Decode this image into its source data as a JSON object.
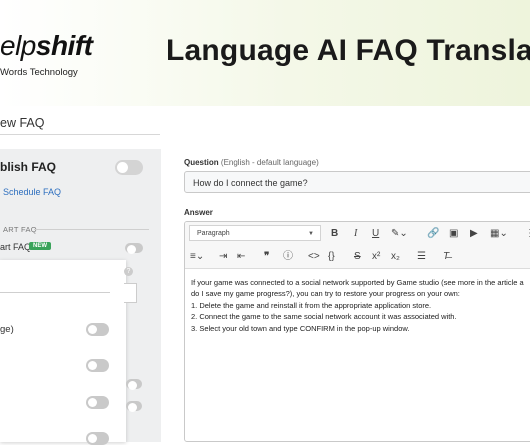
{
  "header": {
    "logo_prefix": "elp",
    "logo_bold": "shift",
    "logo_tagline": "Words Technology",
    "headline": "Language AI FAQ Translat"
  },
  "left_panel": {
    "title": "ew FAQ",
    "publish_label": "blish FAQ",
    "schedule_link": "Schedule FAQ",
    "section_label": "ART FAQ",
    "smart_label": "art FAQ",
    "new_badge": "NEW",
    "dropdown_help": "?",
    "dropdown_item": "ge)"
  },
  "form": {
    "question_label": "Question",
    "question_note": "(English - default language)",
    "question_value": "How do I connect the game?",
    "answer_label": "Answer",
    "paragraph_select": "Paragraph",
    "answer_lines": [
      "If your game was connected to a social network supported by Game studio (see more in the article a",
      "do I save my game progress?), you can try to restore your progress on your own:",
      "1. Delete the game and reinstall it from the appropriate application store.",
      "2. Connect the game to the same social network account it was associated with.",
      "3. Select your old town and type CONFIRM in the pop-up window."
    ]
  },
  "colors": {
    "accent_link": "#2e6fbf",
    "badge_green": "#3aa35a"
  }
}
